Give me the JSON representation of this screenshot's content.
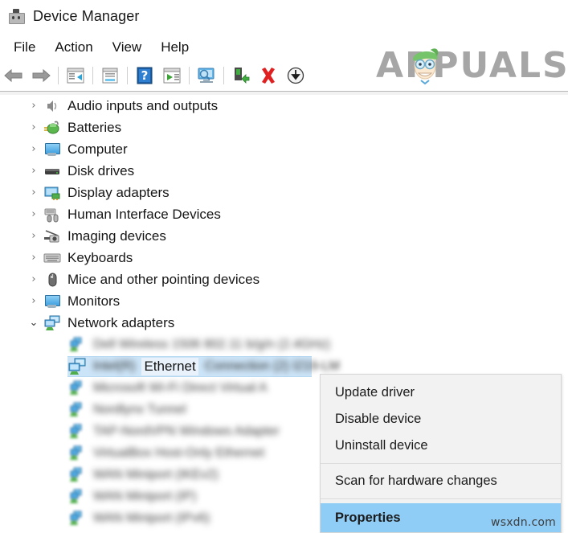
{
  "window": {
    "title": "Device Manager",
    "icon": "device-plug-icon"
  },
  "menubar": {
    "items": [
      {
        "label": "File"
      },
      {
        "label": "Action"
      },
      {
        "label": "View"
      },
      {
        "label": "Help"
      }
    ]
  },
  "toolbar": {
    "buttons": [
      {
        "name": "back-arrow-icon",
        "tooltip": "Back"
      },
      {
        "name": "forward-arrow-icon",
        "tooltip": "Forward"
      },
      {
        "name": "show-hide-console-tree-icon",
        "tooltip": "Show/Hide Console Tree"
      },
      {
        "name": "properties-icon",
        "tooltip": "Properties"
      },
      {
        "name": "help-icon",
        "tooltip": "Help"
      },
      {
        "name": "update-driver-icon",
        "tooltip": "Update Driver Software"
      },
      {
        "name": "scan-hardware-changes-icon",
        "tooltip": "Scan for hardware changes"
      },
      {
        "name": "enable-device-icon",
        "tooltip": "Enable device"
      },
      {
        "name": "uninstall-device-icon",
        "tooltip": "Uninstall device"
      },
      {
        "name": "disable-device-icon",
        "tooltip": "Disable device"
      }
    ]
  },
  "watermark": {
    "brand": "APPUALS",
    "brand_prefix": "A",
    "brand_suffix": "PUALS",
    "site": "wsxdn.com",
    "brand_color": "#a6a6a6"
  },
  "tree": {
    "items": [
      {
        "label": "Audio inputs and outputs",
        "icon": "speaker-icon",
        "expanded": false
      },
      {
        "label": "Batteries",
        "icon": "battery-icon",
        "expanded": false
      },
      {
        "label": "Computer",
        "icon": "computer-icon",
        "expanded": false
      },
      {
        "label": "Disk drives",
        "icon": "disk-drive-icon",
        "expanded": false
      },
      {
        "label": "Display adapters",
        "icon": "display-adapter-icon",
        "expanded": false
      },
      {
        "label": "Human Interface Devices",
        "icon": "hid-icon",
        "expanded": false
      },
      {
        "label": "Imaging devices",
        "icon": "imaging-device-icon",
        "expanded": false
      },
      {
        "label": "Keyboards",
        "icon": "keyboard-icon",
        "expanded": false
      },
      {
        "label": "Mice and other pointing devices",
        "icon": "mouse-icon",
        "expanded": false
      },
      {
        "label": "Monitors",
        "icon": "monitor-icon",
        "expanded": false
      },
      {
        "label": "Network adapters",
        "icon": "network-adapter-icon",
        "expanded": true
      }
    ],
    "chevron_collapsed": "›",
    "chevron_expanded": "⌄",
    "network_children": [
      {
        "label": "Dell Wireless 1506 802.11 b/g/n (2.4GHz)",
        "blurred": true
      },
      {
        "label_prefix": "Intel(R)",
        "label_sharp": "Ethernet",
        "label_suffix": "Connection (2) I219-LM",
        "selected": true,
        "blurred_partial": true
      },
      {
        "label": "Microsoft Wi-Fi Direct Virtual A",
        "blurred": true
      },
      {
        "label": "Nordlynx Tunnel",
        "blurred": true
      },
      {
        "label": "TAP-NordVPN Windows Adapter",
        "blurred": true
      },
      {
        "label": "VirtualBox Host-Only Ethernet",
        "blurred": true
      },
      {
        "label": "WAN Miniport (IKEv2)",
        "blurred": true
      },
      {
        "label": "WAN Miniport (IP)",
        "blurred": true
      },
      {
        "label": "WAN Miniport (IPv6)",
        "blurred": true
      }
    ]
  },
  "context_menu": {
    "items": [
      {
        "label": "Update driver",
        "selected": false
      },
      {
        "label": "Disable device",
        "selected": false
      },
      {
        "label": "Uninstall device",
        "selected": false
      },
      {
        "separator": true
      },
      {
        "label": "Scan for hardware changes",
        "selected": false
      },
      {
        "separator": true
      },
      {
        "label": "Properties",
        "selected": true
      }
    ],
    "highlight_color": "#8fcdf7"
  }
}
